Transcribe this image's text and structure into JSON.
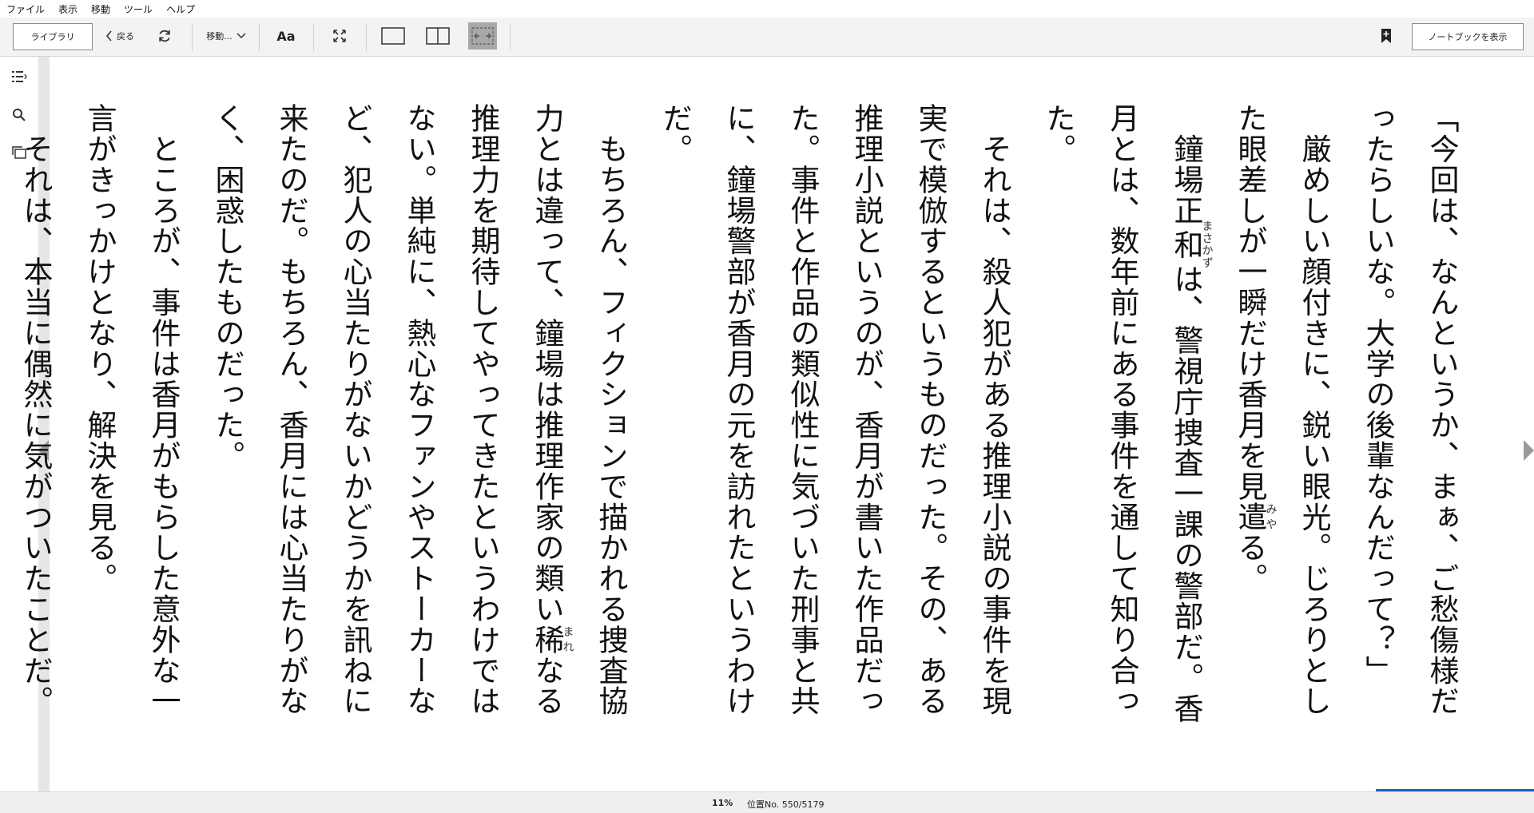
{
  "menu": [
    "ファイル",
    "表示",
    "移動",
    "ツール",
    "ヘルプ"
  ],
  "toolbar": {
    "library": "ライブラリ",
    "back": "戻る",
    "goto": "移動...",
    "font": "Aa",
    "notebook": "ノートブックを表示"
  },
  "book": {
    "paragraphs": [
      [
        "「今回は、なんというか、まぁ、ご愁傷様だったらしいな。大学の後輩なんだって？」"
      ],
      [
        "　厳めしい顔付きに、鋭い眼光。じろりとした眼差しが一瞬だけ香月を見",
        {
          "base": "遣",
          "ruby": "みや"
        },
        "る。"
      ],
      [
        "　鐘場正",
        {
          "base": "和",
          "ruby": "まさかず"
        },
        "は、警視庁捜査一課の警部だ。香月とは、数年前にある事件を通して知り合った。"
      ],
      [
        "　それは、殺人犯がある推理小説の事件を現実で模倣するというものだった。その、ある推理小説というのが、香月が書いた作品だった。事件と作品の類似性に気づいた刑事と共に、鐘場警部が香月の元を訪れたというわけだ。"
      ],
      [
        "　もちろん、フィクションで描かれる捜査協力とは違って、鐘場は推理作家の類い",
        {
          "base": "稀",
          "ruby": "まれ"
        },
        "なる推理力を期待してやってきたというわけではない。単純に、熱心なファンやストーカーなど、犯人の心当たりがないかどうかを訊ねに来たのだ。もちろん、香月には心当たりがなく、困惑したものだった。"
      ],
      [
        "　ところが、事件は香月がもらした意外な一言がきっかけとなり、解決を見る。"
      ],
      [
        "　それは、本当に偶然に気がついたことだ。香月には、推理小説に描かれる名探偵のような推"
      ]
    ]
  },
  "status": {
    "percent": "11%",
    "location": "位置No. 550/5179"
  }
}
